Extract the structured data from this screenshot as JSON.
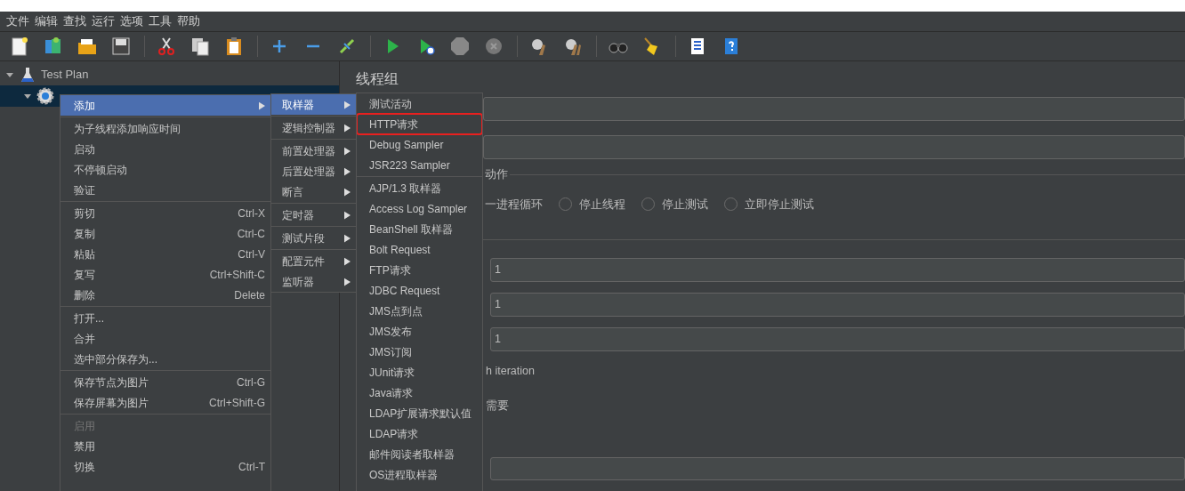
{
  "menubar": [
    "文件",
    "编辑",
    "查找",
    "运行",
    "选项",
    "工具",
    "帮助"
  ],
  "tree": [
    {
      "label": "Test Plan",
      "kind": "plan",
      "expanded": true,
      "selected": false,
      "children": [
        {
          "kind": "group",
          "expanded": true,
          "selected": true
        }
      ]
    }
  ],
  "panel": {
    "title": "线程组",
    "group_label": "动作",
    "radio_lead": "一进程循环",
    "radios": [
      {
        "label": "停止线程",
        "selected": false
      },
      {
        "label": "停止测试",
        "selected": false
      },
      {
        "label": "立即停止测试",
        "selected": false
      }
    ],
    "fields": [
      {
        "value": "1"
      },
      {
        "value": "1"
      },
      {
        "value": "1"
      }
    ],
    "texts": [
      "h iteration",
      "需要"
    ]
  },
  "context_menu": [
    {
      "kind": "item",
      "label": "添加",
      "submenu": true,
      "selected": true
    },
    {
      "kind": "separator"
    },
    {
      "kind": "item",
      "label": "为子线程添加响应时间"
    },
    {
      "kind": "item",
      "label": "启动"
    },
    {
      "kind": "item",
      "label": "不停顿启动"
    },
    {
      "kind": "item",
      "label": "验证"
    },
    {
      "kind": "separator"
    },
    {
      "kind": "item",
      "label": "剪切",
      "shortcut": "Ctrl-X"
    },
    {
      "kind": "item",
      "label": "复制",
      "shortcut": "Ctrl-C"
    },
    {
      "kind": "item",
      "label": "粘贴",
      "shortcut": "Ctrl-V"
    },
    {
      "kind": "item",
      "label": "复写",
      "shortcut": "Ctrl+Shift-C"
    },
    {
      "kind": "item",
      "label": "删除",
      "shortcut": "Delete"
    },
    {
      "kind": "separator"
    },
    {
      "kind": "item",
      "label": "打开..."
    },
    {
      "kind": "item",
      "label": "合并"
    },
    {
      "kind": "item",
      "label": "选中部分保存为..."
    },
    {
      "kind": "separator"
    },
    {
      "kind": "item",
      "label": "保存节点为图片",
      "shortcut": "Ctrl-G"
    },
    {
      "kind": "item",
      "label": "保存屏幕为图片",
      "shortcut": "Ctrl+Shift-G"
    },
    {
      "kind": "separator"
    },
    {
      "kind": "item",
      "label": "启用",
      "disabled": true
    },
    {
      "kind": "item",
      "label": "禁用"
    },
    {
      "kind": "item",
      "label": "切换",
      "shortcut": "Ctrl-T"
    }
  ],
  "add_menu": [
    {
      "kind": "item",
      "label": "取样器",
      "submenu": true,
      "selected": true
    },
    {
      "kind": "separator"
    },
    {
      "kind": "item",
      "label": "逻辑控制器",
      "submenu": true
    },
    {
      "kind": "separator"
    },
    {
      "kind": "item",
      "label": "前置处理器",
      "submenu": true
    },
    {
      "kind": "item",
      "label": "后置处理器",
      "submenu": true
    },
    {
      "kind": "item",
      "label": "断言",
      "submenu": true
    },
    {
      "kind": "separator"
    },
    {
      "kind": "item",
      "label": "定时器",
      "submenu": true
    },
    {
      "kind": "separator"
    },
    {
      "kind": "item",
      "label": "测试片段",
      "submenu": true
    },
    {
      "kind": "separator"
    },
    {
      "kind": "item",
      "label": "配置元件",
      "submenu": true
    },
    {
      "kind": "item",
      "label": "监听器",
      "submenu": true
    }
  ],
  "sampler_menu": [
    {
      "kind": "item",
      "label": "测试活动"
    },
    {
      "kind": "item",
      "label": "HTTP请求",
      "annotated": true
    },
    {
      "kind": "item",
      "label": "Debug Sampler"
    },
    {
      "kind": "item",
      "label": "JSR223 Sampler"
    },
    {
      "kind": "separator"
    },
    {
      "kind": "item",
      "label": "AJP/1.3 取样器"
    },
    {
      "kind": "item",
      "label": "Access Log Sampler"
    },
    {
      "kind": "item",
      "label": "BeanShell 取样器"
    },
    {
      "kind": "item",
      "label": "Bolt Request"
    },
    {
      "kind": "item",
      "label": "FTP请求"
    },
    {
      "kind": "item",
      "label": "JDBC Request"
    },
    {
      "kind": "item",
      "label": "JMS点到点"
    },
    {
      "kind": "item",
      "label": "JMS发布"
    },
    {
      "kind": "item",
      "label": "JMS订阅"
    },
    {
      "kind": "item",
      "label": "JUnit请求"
    },
    {
      "kind": "item",
      "label": "Java请求"
    },
    {
      "kind": "item",
      "label": "LDAP扩展请求默认值"
    },
    {
      "kind": "item",
      "label": "LDAP请求"
    },
    {
      "kind": "item",
      "label": "邮件阅读者取样器"
    },
    {
      "kind": "item",
      "label": "OS进程取样器"
    }
  ]
}
